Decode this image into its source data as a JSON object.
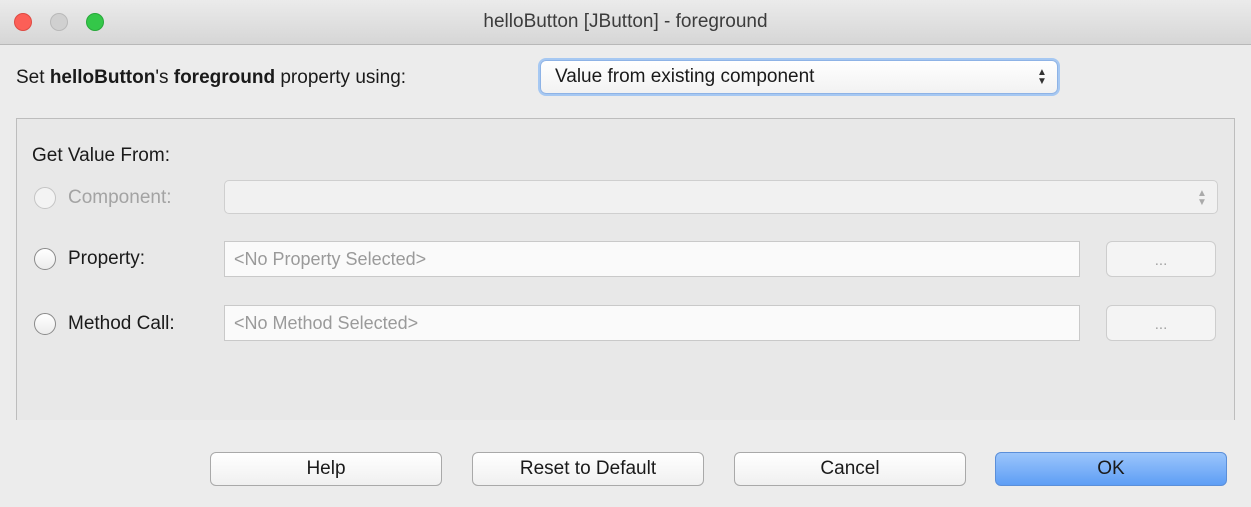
{
  "window": {
    "title": "helloButton [JButton] - foreground"
  },
  "header": {
    "prefix": "Set ",
    "component_name": "helloButton",
    "possessive": "'s ",
    "property_name": "foreground",
    "suffix": " property using:",
    "mode_select": {
      "value": "Value from existing component",
      "icon": "updown-arrows-icon"
    }
  },
  "group": {
    "title": "Get Value From:",
    "rows": [
      {
        "label": "Component:",
        "enabled": false,
        "value": ""
      },
      {
        "label": "Property:",
        "enabled": true,
        "placeholder": "<No Property Selected>",
        "browse_label": "..."
      },
      {
        "label": "Method Call:",
        "enabled": true,
        "placeholder": "<No Method Selected>",
        "browse_label": "..."
      }
    ]
  },
  "buttons": {
    "help": "Help",
    "reset": "Reset to Default",
    "cancel": "Cancel",
    "ok": "OK"
  },
  "colors": {
    "close": "#fc5f57",
    "minimize": "#d0d0d0",
    "zoom": "#34c749",
    "accent": "#5e9ef5"
  }
}
